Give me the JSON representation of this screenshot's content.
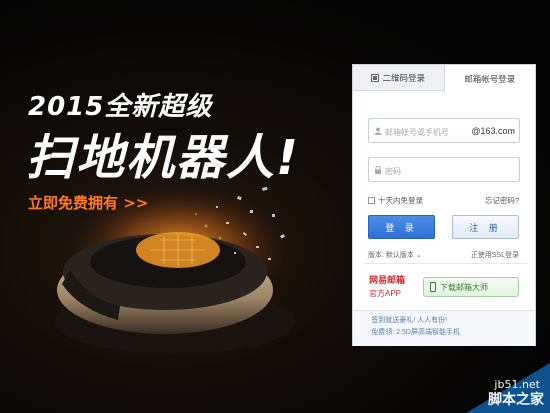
{
  "promo": {
    "headline_top": "2015全新超级",
    "headline_main": "扫地机器人!",
    "cta": "立即免费拥有 >>"
  },
  "login": {
    "tabs": [
      {
        "label": "二维码登录"
      },
      {
        "label": "邮箱帐号登录"
      }
    ],
    "username_placeholder": "邮箱帐号或手机号",
    "domain_suffix": "@163.com",
    "password_placeholder": "密码",
    "remember_label": "十天内免登录",
    "forgot_label": "忘记密码?",
    "login_label": "登 录",
    "register_label": "注 册",
    "version_label": "版本: 默认版本 ⌄",
    "ssl_label": "正使用SSL登录",
    "brand_name": "网易邮箱",
    "brand_sub": "官方APP",
    "download_label": "下载邮箱大师",
    "news": [
      "签到就送豪礼! 人人有份!",
      "免费领: 2.5D屏高端智能手机"
    ]
  },
  "watermark": {
    "site": "jb51.net",
    "name": "脚本之家"
  },
  "colors": {
    "accent": "#2f6fd6",
    "cta": "#ff7a1a",
    "brand": "#d4282b"
  }
}
